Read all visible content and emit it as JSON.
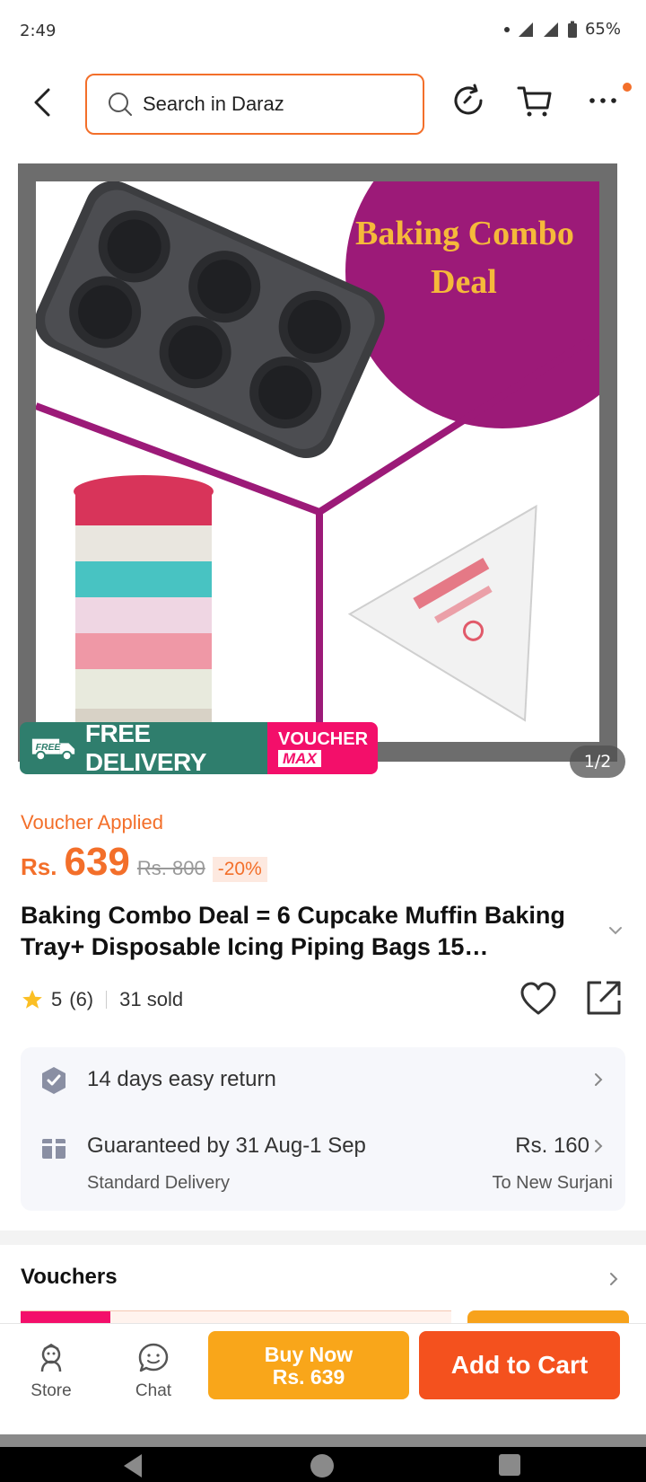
{
  "status_bar": {
    "time": "2:49",
    "battery": "65%"
  },
  "header": {
    "search_placeholder": "Search in Daraz"
  },
  "gallery": {
    "image_text_line1": "Baking Combo",
    "image_text_line2": "Deal",
    "badge_free": "FREE DELIVERY",
    "badge_free_truck": "FREE",
    "badge_voucher_line1": "VOUCHER",
    "badge_voucher_line2": "MAX",
    "pager": "1/2"
  },
  "price": {
    "voucher_applied": "Voucher Applied",
    "currency": "Rs.",
    "current": "639",
    "original": "Rs. 800",
    "discount": "-20%"
  },
  "product": {
    "title": "Baking Combo Deal = 6 Cupcake Muffin Baking Tray+ Disposable Icing Piping Bags 15…",
    "rating": "5",
    "rating_count": "(6)",
    "sold": "31 sold"
  },
  "services": {
    "return_text": "14 days easy return",
    "delivery_guarantee": "Guaranteed by 31 Aug-1 Sep",
    "delivery_type": "Standard Delivery",
    "delivery_fee": "Rs. 160",
    "delivery_destination": "To New Surjani"
  },
  "vouchers": {
    "title": "Vouchers"
  },
  "action_bar": {
    "store_label": "Store",
    "chat_label": "Chat",
    "buy_now_line1": "Buy Now",
    "buy_now_line2": "Rs. 639",
    "add_to_cart": "Add to Cart"
  },
  "colors": {
    "brand_orange": "#f36f2a",
    "buy_now": "#f9a61a",
    "add_to_cart": "#f4511e",
    "free_delivery_green": "#2f7e6d",
    "voucher_pink": "#f30f6a",
    "image_magenta": "#9c1a78"
  }
}
